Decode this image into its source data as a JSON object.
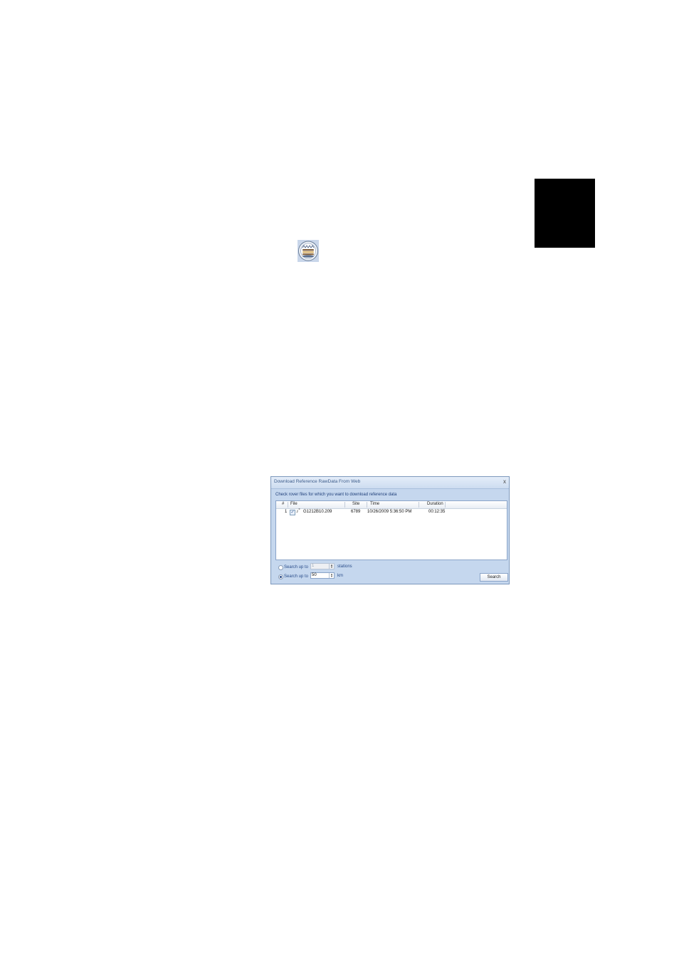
{
  "dialog": {
    "title": "Download Reference RawData From Web",
    "close_label": "x",
    "instruction": "Check rover files for which you want to download reference data",
    "columns": [
      "#",
      "File",
      "Site",
      "Time",
      "Duration"
    ],
    "rows": [
      {
        "num": "1",
        "checked": "✓",
        "file": "G1212B10.209",
        "site": "6789",
        "time": "10/26/2009 5:36:50 PM",
        "duration": "00:12:35"
      }
    ],
    "option_stations": {
      "label": "Search up to",
      "value": "1",
      "unit": "stations"
    },
    "option_km": {
      "label": "Search up to",
      "value": "50",
      "unit": "km"
    },
    "search_button": "Search"
  }
}
